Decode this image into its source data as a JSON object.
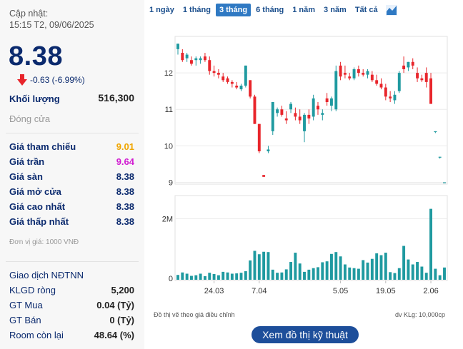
{
  "header": {
    "updated_label": "Cập nhật:",
    "updated_time": "15:15 T2, 09/06/2025"
  },
  "quote": {
    "price": "8.38",
    "change": "-0.63 (-6.99%)",
    "down_color": "#e8252b",
    "price_color": "#0b2a6e"
  },
  "volume": {
    "label": "Khối lượng",
    "value": "516,300"
  },
  "status": "Đóng cửa",
  "stats": [
    {
      "label": "Giá tham chiếu",
      "value": "9.01",
      "color": "#f0a500"
    },
    {
      "label": "Giá trần",
      "value": "9.64",
      "color": "#d11dd1"
    },
    {
      "label": "Giá sàn",
      "value": "8.38",
      "color": "#0b2a6e"
    },
    {
      "label": "Giá mở cửa",
      "value": "8.38",
      "color": "#0b2a6e"
    },
    {
      "label": "Giá cao nhất",
      "value": "8.38",
      "color": "#0b2a6e"
    },
    {
      "label": "Giá thấp nhất",
      "value": "8.38",
      "color": "#0b2a6e"
    }
  ],
  "unit_note": "Đơn vị giá: 1000 VNĐ",
  "foreign": {
    "title": "Giao dịch NĐTNN",
    "rows": [
      {
        "label": "KLGD ròng",
        "value": "5,200"
      },
      {
        "label": "GT Mua",
        "value": "0.04 (Tỷ)"
      },
      {
        "label": "GT Bán",
        "value": "0 (Tỷ)"
      },
      {
        "label": "Room còn lại",
        "value": "48.64 (%)"
      }
    ]
  },
  "ranges": [
    "1 ngày",
    "1 tháng",
    "3 tháng",
    "6 tháng",
    "1 năm",
    "3 năm",
    "Tất cả"
  ],
  "active_range": "3 tháng",
  "notes": {
    "left": "Đồ thị vẽ theo giá điều chỉnh",
    "right": "dv KLg: 10,000cp"
  },
  "tech_button": "Xem đồ thị kỹ thuật",
  "chart_data": {
    "type": "candlestick",
    "up_color": "#1f9aa0",
    "down_color": "#e8252b",
    "price_ticks": [
      "12",
      "11",
      "10",
      "9"
    ],
    "price_tick_values": [
      12,
      11,
      10,
      9
    ],
    "price_range": [
      8.95,
      13.0
    ],
    "volume_ticks": [
      "2M",
      "0"
    ],
    "volume_tick_values": [
      2000000,
      0
    ],
    "volume_range": [
      0,
      2750000
    ],
    "x_labels": [
      "24.03",
      "7.04",
      "5.05",
      "19.05",
      "2.06"
    ],
    "x_label_index": [
      8,
      18,
      36,
      46,
      56
    ],
    "candles": [
      [
        12.65,
        12.8,
        12.5,
        12.8
      ],
      [
        12.55,
        12.65,
        12.3,
        12.35
      ],
      [
        12.4,
        12.55,
        12.3,
        12.5
      ],
      [
        12.35,
        12.45,
        12.2,
        12.25
      ],
      [
        12.35,
        12.45,
        12.2,
        12.4
      ],
      [
        12.35,
        12.45,
        12.25,
        12.4
      ],
      [
        12.45,
        12.55,
        12.3,
        12.35
      ],
      [
        12.35,
        12.45,
        11.95,
        12.05
      ],
      [
        12.05,
        12.2,
        11.9,
        12.0
      ],
      [
        12.0,
        12.1,
        11.85,
        11.95
      ],
      [
        11.9,
        12.0,
        11.75,
        11.8
      ],
      [
        11.85,
        11.9,
        11.7,
        11.75
      ],
      [
        11.75,
        11.8,
        11.6,
        11.7
      ],
      [
        11.65,
        11.75,
        11.55,
        11.6
      ],
      [
        11.55,
        11.7,
        11.5,
        11.65
      ],
      [
        11.65,
        12.2,
        11.6,
        12.2
      ],
      [
        11.8,
        11.8,
        11.3,
        11.35
      ],
      [
        11.35,
        11.4,
        10.6,
        10.6
      ],
      [
        10.6,
        10.6,
        9.8,
        9.85
      ],
      [
        9.2,
        9.2,
        9.15,
        9.15
      ],
      [
        9.85,
        10.0,
        9.8,
        9.9
      ],
      [
        10.4,
        11.2,
        10.3,
        11.2
      ],
      [
        10.9,
        11.05,
        10.8,
        11.0
      ],
      [
        11.0,
        11.1,
        10.8,
        10.85
      ],
      [
        10.75,
        10.95,
        10.6,
        10.7
      ],
      [
        11.0,
        11.2,
        10.9,
        11.15
      ],
      [
        10.9,
        11.05,
        10.7,
        10.8
      ],
      [
        10.8,
        11.0,
        10.6,
        10.7
      ],
      [
        10.4,
        10.9,
        10.1,
        10.85
      ],
      [
        10.85,
        11.0,
        10.6,
        10.75
      ],
      [
        10.8,
        11.4,
        10.7,
        11.3
      ],
      [
        11.1,
        11.2,
        10.85,
        11.0
      ],
      [
        10.85,
        11.0,
        10.7,
        10.9
      ],
      [
        11.3,
        11.45,
        11.1,
        11.2
      ],
      [
        11.1,
        11.35,
        10.95,
        11.3
      ],
      [
        11.0,
        12.2,
        10.95,
        12.05
      ],
      [
        12.2,
        12.3,
        11.8,
        11.9
      ],
      [
        12.0,
        12.2,
        11.85,
        11.95
      ],
      [
        11.9,
        12.0,
        11.8,
        11.85
      ],
      [
        11.85,
        12.15,
        11.8,
        12.1
      ],
      [
        12.1,
        12.2,
        11.9,
        12.0
      ],
      [
        12.0,
        12.1,
        11.9,
        11.95
      ],
      [
        11.95,
        12.1,
        11.85,
        12.05
      ],
      [
        11.95,
        12.05,
        11.75,
        11.8
      ],
      [
        11.8,
        11.95,
        11.65,
        11.7
      ],
      [
        11.7,
        11.85,
        11.55,
        11.6
      ],
      [
        11.6,
        11.7,
        11.25,
        11.35
      ],
      [
        11.35,
        11.5,
        11.2,
        11.3
      ],
      [
        11.25,
        11.5,
        11.15,
        11.4
      ],
      [
        11.5,
        12.05,
        11.45,
        12.0
      ],
      [
        12.2,
        12.45,
        12.0,
        12.1
      ],
      [
        12.15,
        12.3,
        12.05,
        12.3
      ],
      [
        12.3,
        12.4,
        12.1,
        12.2
      ],
      [
        12.0,
        12.15,
        11.75,
        11.85
      ],
      [
        11.85,
        11.95,
        11.75,
        11.8
      ],
      [
        12.0,
        12.15,
        11.6,
        11.75
      ],
      [
        11.85,
        12.0,
        11.15,
        11.15
      ],
      [
        10.4,
        10.4,
        10.35,
        10.4
      ],
      [
        9.7,
        9.7,
        9.65,
        9.7
      ],
      [
        9.0,
        9.0,
        8.98,
        9.0
      ]
    ],
    "volumes": [
      180000,
      260000,
      220000,
      150000,
      170000,
      220000,
      140000,
      250000,
      210000,
      170000,
      280000,
      260000,
      220000,
      230000,
      250000,
      300000,
      650000,
      960000,
      850000,
      930000,
      920000,
      350000,
      250000,
      260000,
      360000,
      600000,
      900000,
      550000,
      280000,
      350000,
      400000,
      430000,
      590000,
      620000,
      860000,
      920000,
      780000,
      520000,
      420000,
      400000,
      380000,
      660000,
      580000,
      700000,
      880000,
      820000,
      900000,
      270000,
      240000,
      400000,
      1120000,
      680000,
      520000,
      600000,
      450000,
      250000,
      2320000,
      380000,
      170000,
      420000
    ]
  }
}
